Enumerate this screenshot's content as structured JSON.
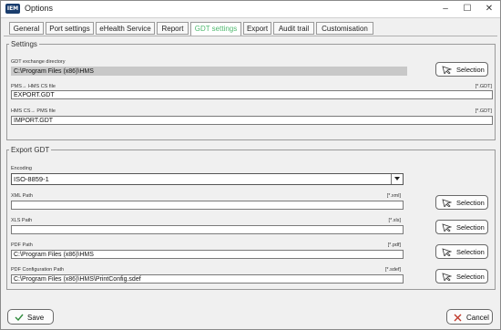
{
  "window": {
    "title": "Options",
    "logo_text": "IEM"
  },
  "tabs": [
    {
      "label": "General"
    },
    {
      "label": "Port settings"
    },
    {
      "label": "eHealth Service"
    },
    {
      "label": "Report"
    },
    {
      "label": "GDT settings",
      "active": true
    },
    {
      "label": "Export"
    },
    {
      "label": "Audit trail"
    },
    {
      "label": "Customisation"
    }
  ],
  "settings": {
    "legend": "Settings",
    "exchange_dir_label": "GDT exchange directory",
    "exchange_dir_value": "C:\\Program Files (x86)\\HMS",
    "pms_file_label": "PMS→ HMS CS file",
    "pms_file_ext": "[*.GDT]",
    "pms_file_value": "EXPORT.GDT",
    "hms_file_label": "HMS CS→ PMS file",
    "hms_file_ext": "[*.GDT]",
    "hms_file_value": "IMPORT.GDT",
    "selection_label": "Selection"
  },
  "export_gdt": {
    "legend": "Export GDT",
    "encoding_label": "Encoding",
    "encoding_value": "ISO-8859-1",
    "xml_label": "XML Path",
    "xml_ext": "[*.xml]",
    "xml_value": "",
    "xls_label": "XLS Path",
    "xls_ext": "[*.xls]",
    "xls_value": "",
    "pdf_label": "PDF Path",
    "pdf_ext": "[*.pdf]",
    "pdf_value": "C:\\Program Files (x86)\\HMS",
    "pdfconf_label": "PDF Configuration Path",
    "pdfconf_ext": "[*.sdef]",
    "pdfconf_value": "C:\\Program Files (x86)\\HMS\\PrintConfig.sdef",
    "selection_label": "Selection"
  },
  "footer": {
    "save_label": "Save",
    "cancel_label": "Cancel"
  },
  "colors": {
    "active_tab": "#4fb96f",
    "save_check": "#2f8a3c",
    "cancel_x": "#c0392b"
  }
}
